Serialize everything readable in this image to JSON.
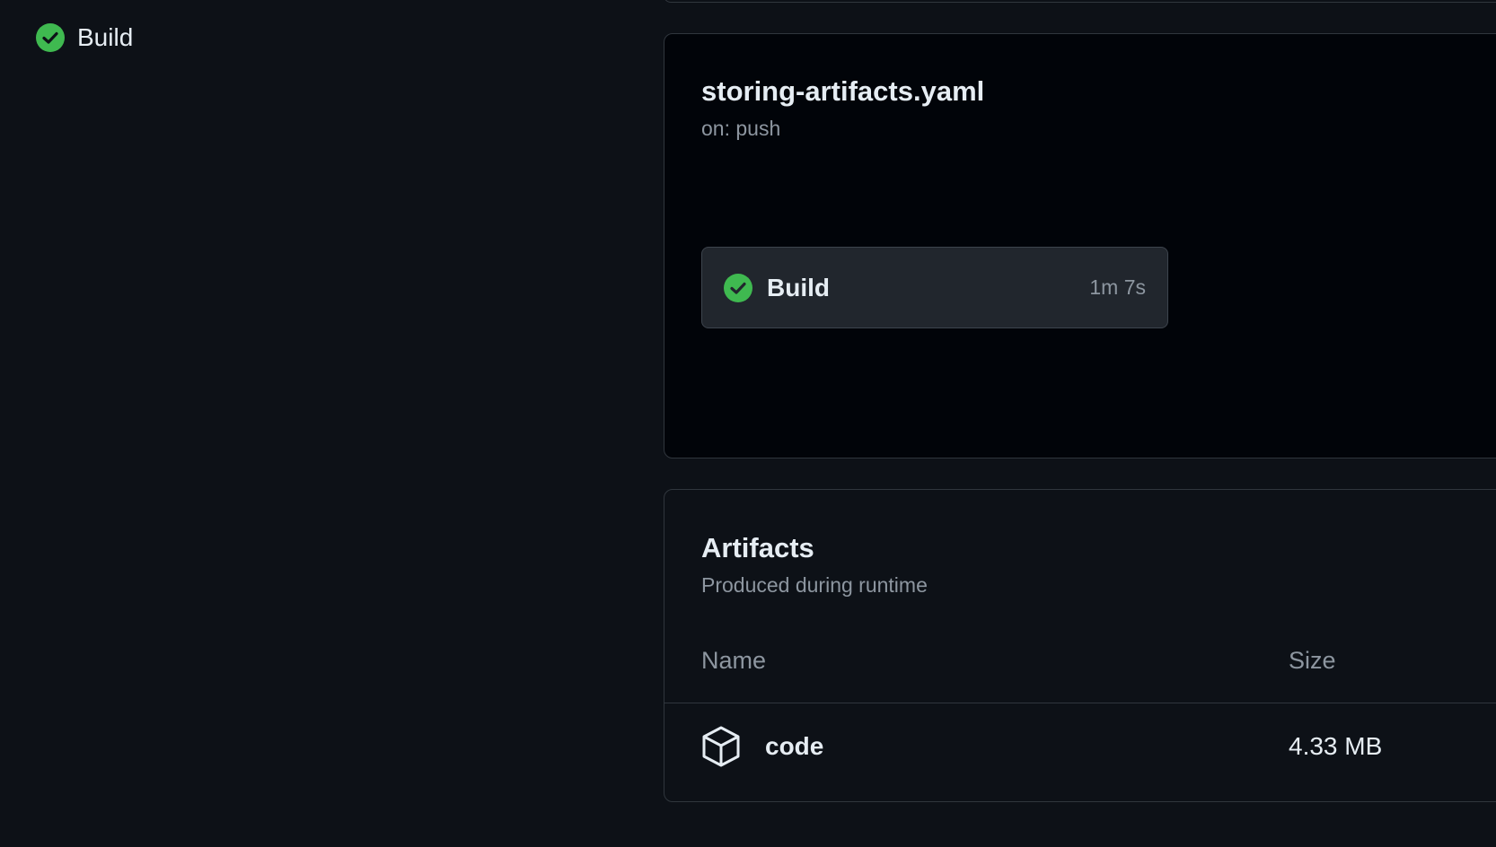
{
  "sidebar": {
    "job": {
      "label": "Build",
      "status": "success"
    }
  },
  "workflow": {
    "file": "storing-artifacts.yaml",
    "trigger": "on: push",
    "job": {
      "name": "Build",
      "duration": "1m 7s",
      "status": "success"
    }
  },
  "artifacts": {
    "title": "Artifacts",
    "subtitle": "Produced during runtime",
    "columns": {
      "name": "Name",
      "size": "Size"
    },
    "items": [
      {
        "name": "code",
        "size": "4.33 MB",
        "icon": "package-icon"
      }
    ]
  },
  "colors": {
    "background": "#0d1117",
    "success": "#3fb950",
    "border": "#30363d",
    "muted_text": "#8d96a0"
  }
}
